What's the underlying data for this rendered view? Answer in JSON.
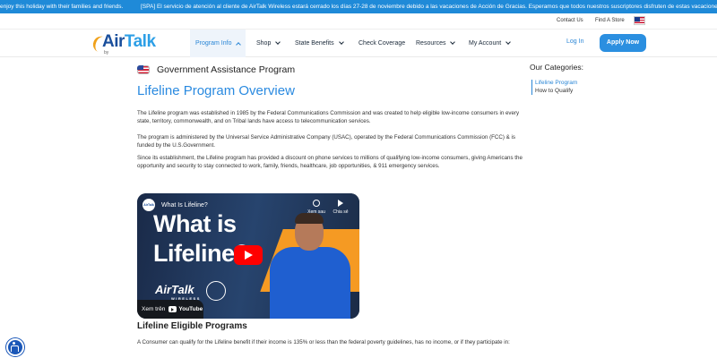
{
  "ticker": {
    "text_1": "enjoy this holiday with their families and friends.",
    "text_2": "[SPA] El servicio de atención al cliente de AirTalk Wireless estará cerrado los días 27-28 de noviembre debido a las vacaciones de Acción de Gracias. Esperamos que todos nuestros suscriptores disfruten de estas vacaciones con"
  },
  "utility_bar": {
    "contact": "Contact Us",
    "find_store": "Find A Store",
    "flag_icon": "us-flag-icon"
  },
  "header": {
    "logo_text_1": "Air",
    "logo_text_2": "Talk",
    "logo_by": "by",
    "nav": [
      {
        "label": "Program Info",
        "active": true
      },
      {
        "label": "Shop"
      },
      {
        "label": "State Benefits"
      },
      {
        "label": "Check Coverage"
      },
      {
        "label": "Resources"
      },
      {
        "label": "My Account"
      }
    ],
    "login": "Log In",
    "apply": "Apply Now"
  },
  "main": {
    "section_label": "Government Assistance Program",
    "title": "Lifeline Program Overview",
    "paragraphs": [
      "The Lifeline program was established in 1985 by the Federal Communications Commission and was created to help eligible low-income consumers in every state, territory, commonwealth, and on Tribal lands have access to telecommunication services.",
      "The program is administered by the Universal Service Administrative Company (USAC), operated by the Federal Communications Commission (FCC) & is funded by the U.S.Government.",
      "Since its establishment, the Lifeline program has provided a discount on phone services to millions of qualifying low-income consumers, giving Americans the opportunity and security to stay connected to work, family, friends, healthcare, job opportunities, & 911 emergency services."
    ],
    "video": {
      "channel": "AirTalk",
      "title": "What Is Lifeline?",
      "thumb_line_1": "What is",
      "thumb_line_2": "Lifeline?",
      "watch_later": "Xem sau",
      "share": "Chia sẻ",
      "brand": "AirTalk",
      "brand_sub": "WIRELESS",
      "watch_on": "Xem trên",
      "youtube": "YouTube"
    },
    "subtitle": "Lifeline Eligible Programs",
    "eligibility_text": "A Consumer can qualify for the Lifeline benefit if their income is 135% or less than the federal poverty guidelines, has no income, or if they participate in:"
  },
  "sidebar": {
    "title": "Our Categories:",
    "items": [
      "Lifeline Program",
      "How to Qualify"
    ]
  },
  "colors": {
    "brand_blue": "#2a8ae0",
    "ticker_bg": "#1f8ad8",
    "apply_bg": "#2b8fe0",
    "play_red": "#ff0000"
  }
}
